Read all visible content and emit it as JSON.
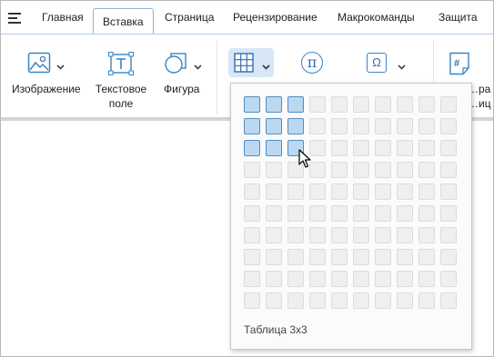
{
  "menu": {
    "icon": "hamburger-menu-icon"
  },
  "tabs": [
    {
      "label": "Главная",
      "active": false
    },
    {
      "label": "Вставка",
      "active": true
    },
    {
      "label": "Страница",
      "active": false
    },
    {
      "label": "Рецензирование",
      "active": false
    },
    {
      "label": "Макрокоманды",
      "active": false
    },
    {
      "label": "Защита",
      "active": false
    }
  ],
  "ribbon": {
    "image": {
      "label": "Изображение",
      "icon": "image-icon"
    },
    "textbox": {
      "label_line1": "Текстовое",
      "label_line2": "поле",
      "icon": "text-box-icon"
    },
    "shape": {
      "label": "Фигура",
      "icon": "shape-icon"
    },
    "table": {
      "icon": "table-grid-icon"
    },
    "formula": {
      "label": "π",
      "icon": "pi-formula-icon"
    },
    "symbol": {
      "label": "Ω",
      "icon": "omega-symbol-icon"
    },
    "field": {
      "label_line1": "…ра",
      "label_line2": "…иц",
      "icon": "page-field-icon",
      "glyph": "#"
    }
  },
  "table_picker": {
    "rows": 10,
    "cols": 10,
    "selected_rows": 3,
    "selected_cols": 3,
    "caption": "Таблица 3х3"
  },
  "colors": {
    "accent": "#4f8dc7",
    "selected_fill": "#bcd8f0",
    "button_highlight": "#d7e7f6"
  }
}
